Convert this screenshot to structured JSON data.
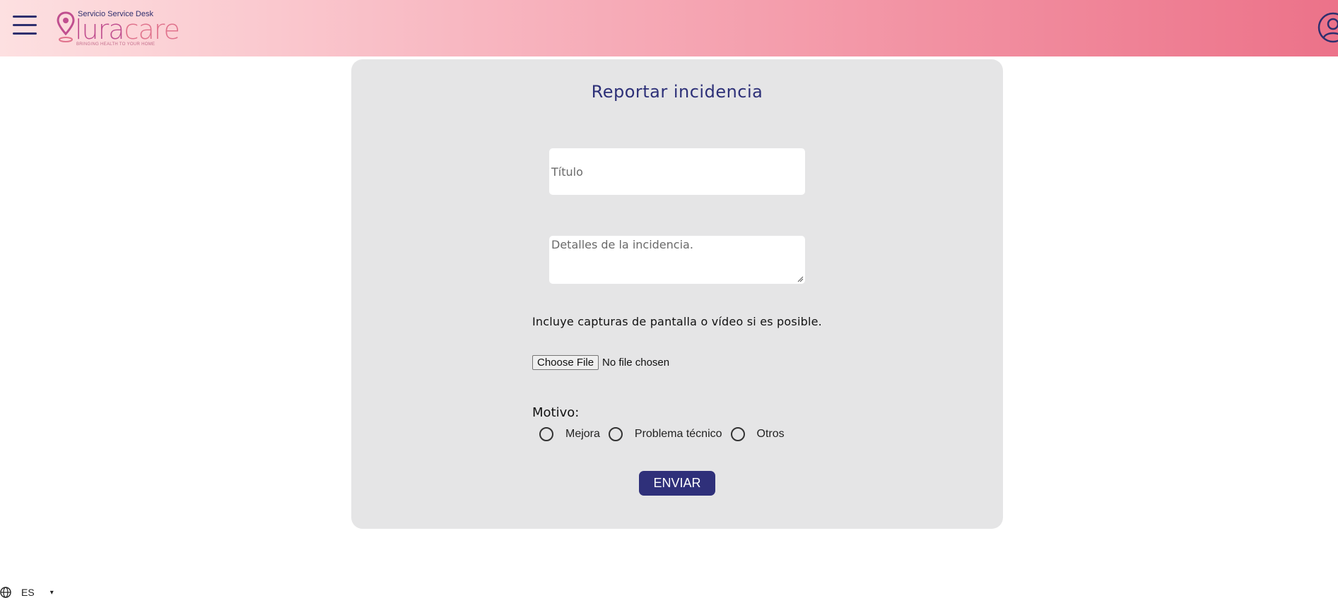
{
  "header": {
    "menu_icon": "hamburger-menu-icon",
    "logo": {
      "subtitle": "Servicio Service Desk",
      "brand_lura": "lura",
      "brand_care": "care",
      "tagline": "BRINGING HEALTH TO YOUR HOME"
    },
    "user_icon": "user-account-icon",
    "colors": {
      "gradient_start": "#fde0e1",
      "gradient_end": "#ec7289",
      "icon": "#2f2f6e"
    }
  },
  "form": {
    "title": "Reportar incidencia",
    "title_field": {
      "value": "",
      "placeholder": "Título"
    },
    "details_field": {
      "value": "",
      "placeholder": "Detalles de la incidencia."
    },
    "hint": "Incluye capturas de pantalla o vídeo si es posible.",
    "file": {
      "button": "Choose File",
      "status": "No file chosen"
    },
    "motivo": {
      "label": "Motivo:",
      "options": [
        "Mejora",
        "Problema técnico",
        "Otros"
      ],
      "selected": null
    },
    "submit": "ENVIAR",
    "colors": {
      "card_bg": "#e5e5e6",
      "accent": "#2f307a"
    }
  },
  "footer": {
    "language": "ES",
    "language_icon": "globe-icon"
  }
}
